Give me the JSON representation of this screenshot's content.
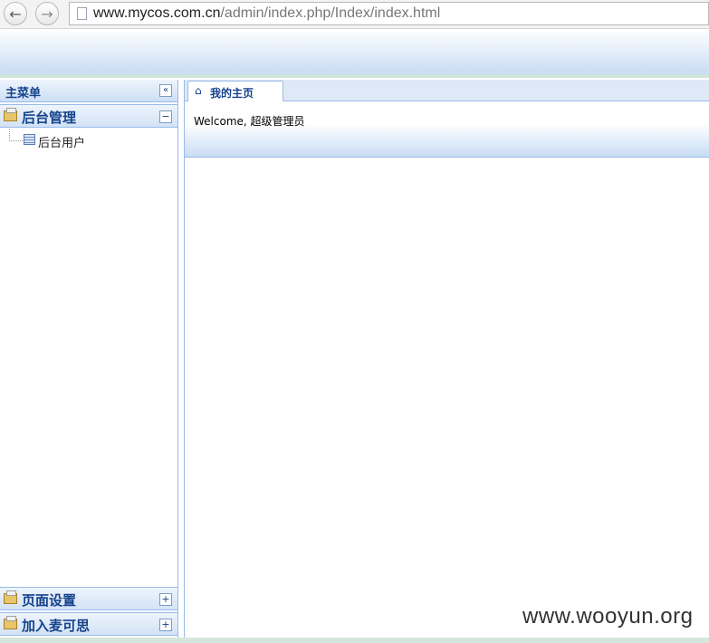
{
  "browser": {
    "url_host": "www.mycos.com.cn",
    "url_path": "/admin/index.php/Index/index.html"
  },
  "left_panel": {
    "title": "主菜单",
    "sections": [
      {
        "label": "后台管理",
        "expanded": true,
        "items": [
          {
            "label": "后台用户"
          }
        ]
      },
      {
        "label": "页面设置",
        "expanded": false
      },
      {
        "label": "加入麦可思",
        "expanded": false
      }
    ]
  },
  "tabs": [
    {
      "label": "我的主页",
      "active": true
    }
  ],
  "welcome": {
    "text": "Welcome, 超级管理员"
  },
  "watermark": "www.wooyun.org",
  "colors": {
    "accent": "#15428b",
    "border": "#99bbe8",
    "header_gradient_end": "#c8dcf4"
  },
  "icons": {
    "collapse": "double-chevron-left-icon",
    "minus": "minus-icon",
    "plus": "plus-icon",
    "home": "home-icon"
  }
}
